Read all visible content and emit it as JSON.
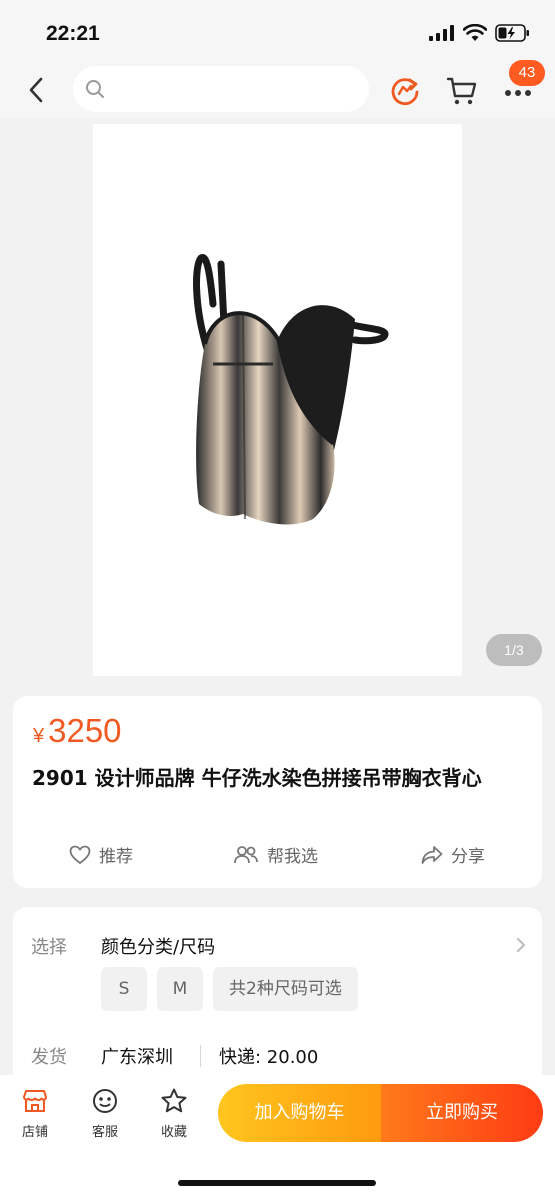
{
  "status_bar": {
    "time": "22:21"
  },
  "nav": {
    "search_placeholder": "",
    "more_badge": "43"
  },
  "gallery": {
    "counter": "1/3"
  },
  "product": {
    "currency": "¥",
    "price": "3250",
    "title": "2901 设计师品牌 牛仔洗水染色拼接吊带胸衣背心",
    "actions": {
      "recommend": "推荐",
      "help_choose": "帮我选",
      "share": "分享"
    }
  },
  "options": {
    "select_label": "选择",
    "select_value": "颜色分类/尺码",
    "chips": [
      "S",
      "M",
      "共2种尺码可选"
    ],
    "ship_label": "发货",
    "ship_city": "广东深圳",
    "ship_express": "快递: 20.00"
  },
  "bottom": {
    "shop": "店铺",
    "service": "客服",
    "favorite": "收藏",
    "add_to_cart": "加入购物车",
    "buy_now": "立即购买"
  },
  "colors": {
    "accent": "#f05a22",
    "cart_btn": "#ffb01a",
    "buy_btn": "#ff4a16"
  }
}
